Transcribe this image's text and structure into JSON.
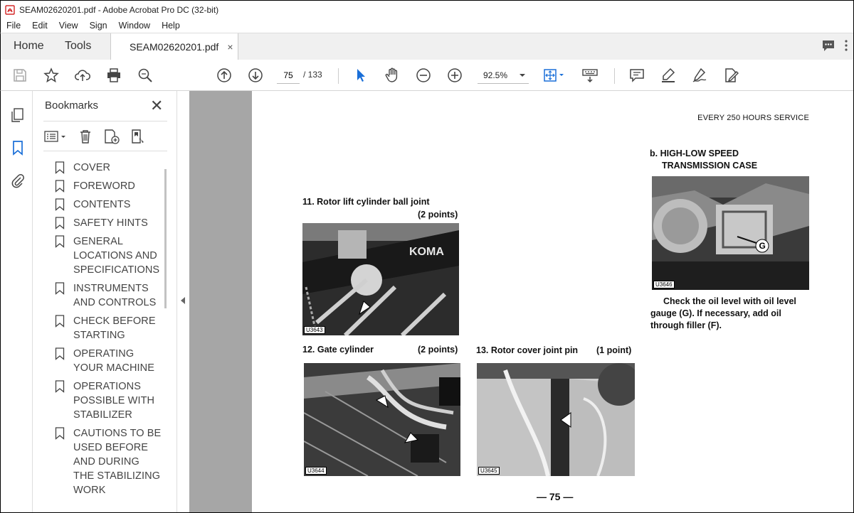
{
  "window": {
    "title": "SEAM02620201.pdf - Adobe Acrobat Pro DC (32-bit)"
  },
  "menu": [
    "File",
    "Edit",
    "View",
    "Sign",
    "Window",
    "Help"
  ],
  "tabs": {
    "home": "Home",
    "tools": "Tools",
    "document": "SEAM02620201.pdf",
    "close": "×"
  },
  "toolbar": {
    "page_current": "75",
    "page_total": "/ 133",
    "zoom": "92.5%"
  },
  "bookmarks": {
    "header": "Bookmarks",
    "close": "✕",
    "items": [
      "COVER",
      "FOREWORD",
      "CONTENTS",
      "SAFETY HINTS",
      "GENERAL LOCATIONS AND SPECIFICATIONS",
      "INSTRUMENTS AND CONTROLS",
      "CHECK BEFORE STARTING",
      "OPERATING YOUR MACHINE",
      "OPERATIONS POSSIBLE WITH STABILIZER",
      "CAUTIONS TO BE USED BEFORE AND DURING THE STABILIZING WORK"
    ]
  },
  "page": {
    "header": "EVERY 250 HOURS SERVICE",
    "section_b_line1": "b. HIGH-LOW SPEED",
    "section_b_line2": "TRANSMISSION CASE",
    "item11_title": "11. Rotor lift cylinder ball joint",
    "item11_points": "(2 points)",
    "item12_title": "12. Gate cylinder",
    "item12_points": "(2 points)",
    "item13_title": "13. Rotor cover joint pin",
    "item13_points": "(1 point)",
    "photo_codes": {
      "p11": "U3643",
      "p12": "U3644",
      "p13": "U3645",
      "pb": "U3646"
    },
    "photo_11_label": "KOMA",
    "photo_b_label": "G",
    "body_b_line1": "Check the oil level with oil level",
    "body_b_line2": "gauge (G). If necessary, add oil",
    "body_b_line3": "through filler (F).",
    "page_number": "— 75 —"
  }
}
